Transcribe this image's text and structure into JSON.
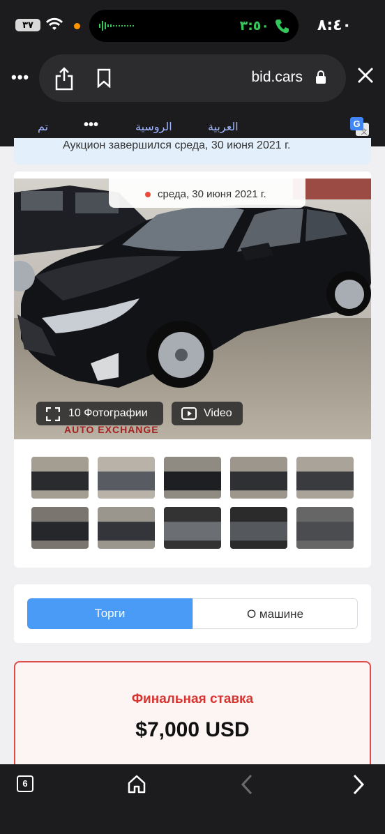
{
  "status_bar": {
    "battery": "٣٧",
    "call_time": "٣:٥٠",
    "clock": "٨:٤٠"
  },
  "browser": {
    "url": "bid.cars",
    "more_label": "•••"
  },
  "translate_bar": {
    "done": "تم",
    "more": "•••",
    "lang_russian": "الروسية",
    "lang_arabic": "العربية"
  },
  "page": {
    "banner_text": "Аукцион завершился среда, 30 июня 2021 г.",
    "date_badge": "среда, 30 июня 2021 г.",
    "photos_button": "10 Фотографии",
    "video_button": "Video",
    "watermark": "AUTO EXCHANGE",
    "thumbnails_count": 10,
    "tabs": [
      {
        "label": "Торги",
        "active": true
      },
      {
        "label": "О машине",
        "active": false
      }
    ],
    "final_bid_label": "Финальная ставка",
    "final_bid_value": "$7,000 USD"
  },
  "bottom_bar": {
    "tabs_count": "6"
  },
  "colors": {
    "accent_blue": "#4a9bf5",
    "bid_red": "#d7332f",
    "call_green": "#34c759"
  }
}
